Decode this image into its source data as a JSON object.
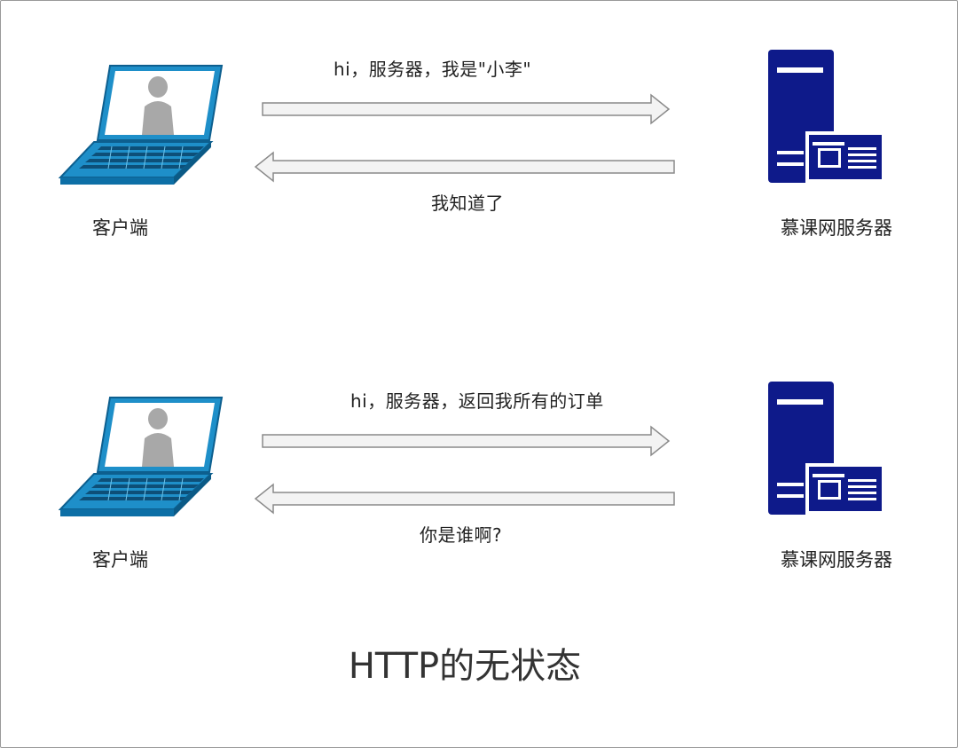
{
  "diagram": {
    "caption": "HTTP的无状态",
    "scenarios": [
      {
        "client_label": "客户端",
        "server_label": "慕课网服务器",
        "request": "hi，服务器，我是\"小李\"",
        "response": "我知道了"
      },
      {
        "client_label": "客户端",
        "server_label": "慕课网服务器",
        "request": "hi，服务器，返回我所有的订单",
        "response": "你是谁啊?"
      }
    ]
  },
  "colors": {
    "laptop_blue": "#1e8fc9",
    "laptop_dark": "#0d5f8f",
    "server_navy": "#0e1a8a",
    "arrow_fill": "#f3f3f3",
    "arrow_stroke": "#8a8a8a"
  },
  "icons": {
    "client": "laptop-user-icon",
    "server": "server-icon"
  }
}
